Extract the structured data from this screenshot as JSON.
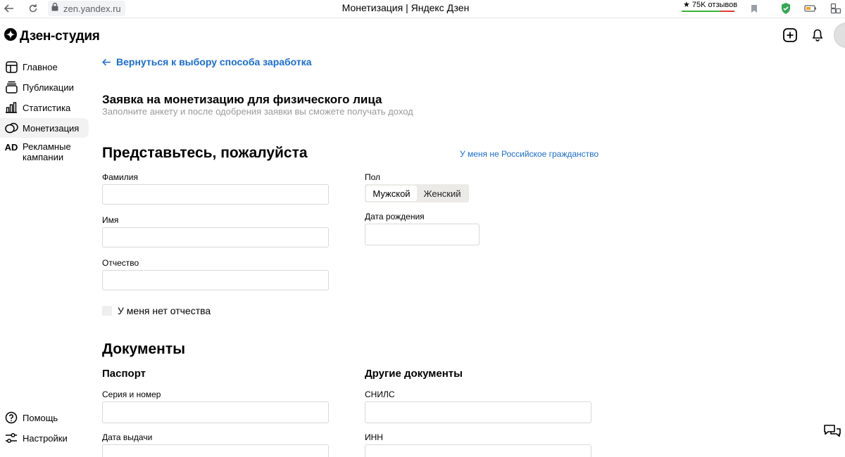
{
  "browser": {
    "url": "zen.yandex.ru",
    "title": "Монетизация | Яндекс Дзен",
    "reviews": "★ 75K отзывов"
  },
  "app": {
    "logo_text": "Дзен-студия"
  },
  "sidebar": {
    "items": [
      {
        "label": "Главное",
        "icon": "layout-icon"
      },
      {
        "label": "Публикации",
        "icon": "publications-icon"
      },
      {
        "label": "Статистика",
        "icon": "stats-icon"
      },
      {
        "label": "Монетизация",
        "icon": "coins-icon",
        "active": true
      },
      {
        "label": "Рекламные кампании",
        "icon": "ad-icon"
      }
    ],
    "bottom": [
      {
        "label": "Помощь",
        "icon": "help-icon"
      },
      {
        "label": "Настройки",
        "icon": "settings-icon"
      }
    ],
    "ad_icon_text": "AD"
  },
  "form": {
    "back_link": "Вернуться к выбору способа заработка",
    "title": "Заявка на монетизацию для физического лица",
    "subtitle": "Заполните анкету и после одобрения заявки вы сможете получать доход",
    "intro_heading": "Представьтесь, пожалуйста",
    "foreign_link": "У меня не Российское гражданство",
    "surname_label": "Фамилия",
    "name_label": "Имя",
    "patronymic_label": "Отчество",
    "no_patronymic_label": "У меня нет отчества",
    "gender_label": "Пол",
    "gender_male": "Мужской",
    "gender_female": "Женский",
    "birthdate_label": "Дата рождения",
    "documents_heading": "Документы",
    "passport_heading": "Паспорт",
    "passport_number_label": "Серия и номер",
    "passport_date_label": "Дата выдачи",
    "other_docs_heading": "Другие документы",
    "snils_label": "СНИЛС",
    "inn_label": "ИНН"
  },
  "colors": {
    "link": "#1a6dd0",
    "active_nav_bg": "#f2f2f2",
    "muted_text": "#999999"
  }
}
